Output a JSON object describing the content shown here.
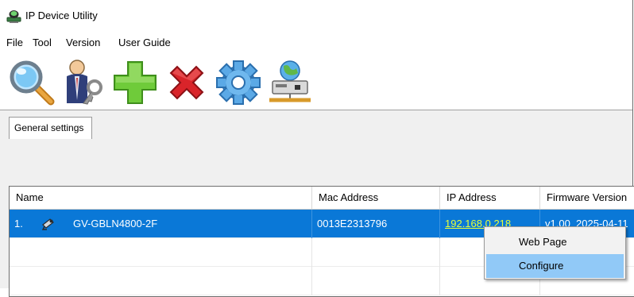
{
  "window": {
    "title": "IP Device Utility",
    "app_icon": "network-camera-icon"
  },
  "menu": [
    "File",
    "Tool",
    "Version",
    "User Guide"
  ],
  "toolbar": [
    {
      "icon": "search-icon",
      "label": "Search devices"
    },
    {
      "icon": "user-key-icon",
      "label": "Login"
    },
    {
      "icon": "add-icon",
      "label": "Add"
    },
    {
      "icon": "delete-icon",
      "label": "Delete"
    },
    {
      "icon": "gear-icon",
      "label": "Settings"
    },
    {
      "icon": "network-device-icon",
      "label": "Network"
    }
  ],
  "tabs": {
    "general": "General settings"
  },
  "table": {
    "columns": [
      "Name",
      "Mac Address",
      "IP Address",
      "Firmware Version"
    ],
    "rows": [
      {
        "index": "1.",
        "icon": "camera-icon",
        "name": "GV-GBLN4800-2F",
        "mac": "0013E2313796",
        "ip": "192.168.0.218",
        "firmware": "v1.00_2025-04-11"
      }
    ]
  },
  "context_menu": {
    "items": [
      "Web Page",
      "Configure"
    ],
    "highlighted": "Configure"
  },
  "colors": {
    "selection": "#0a78d7",
    "link": "#e8ff38",
    "menu_highlight": "#91c9f7"
  }
}
